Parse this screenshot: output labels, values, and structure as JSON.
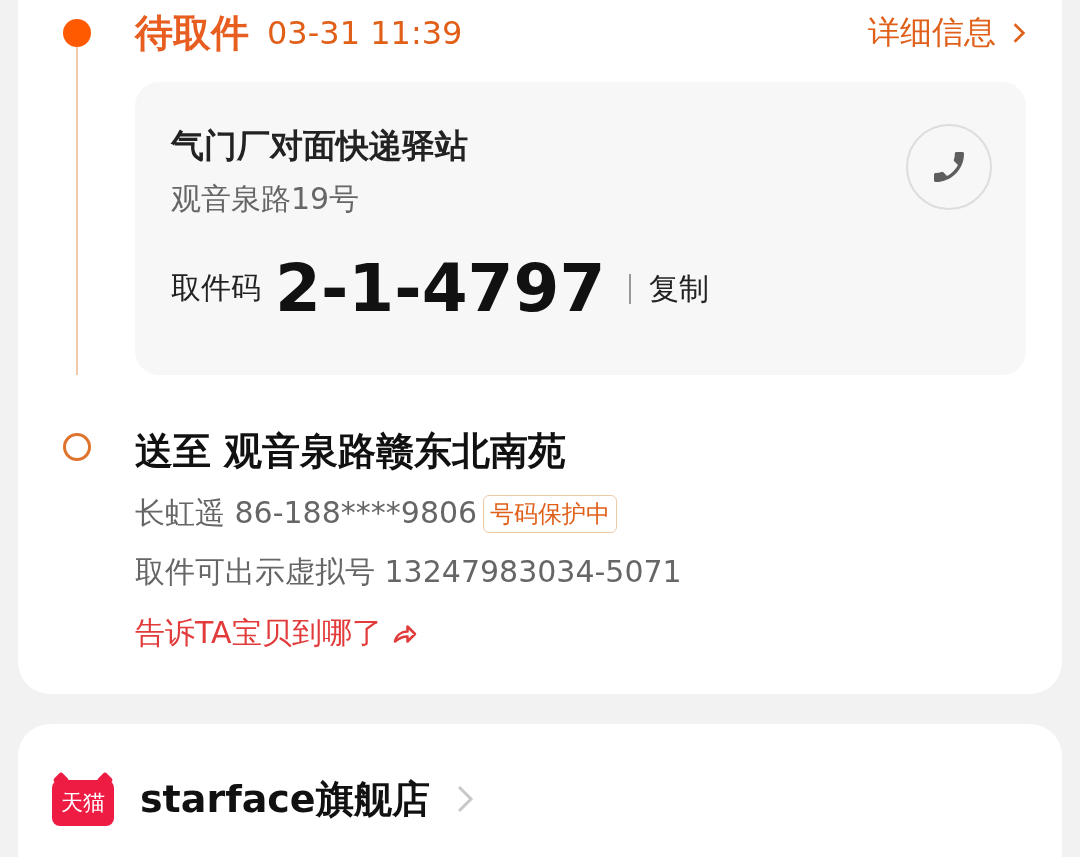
{
  "pickup": {
    "current": true,
    "status": "待取件",
    "time": "03-31 11:39",
    "details_link": "详细信息",
    "station": {
      "name": "气门厂对面快递驿站",
      "address": "观音泉路19号",
      "code_label": "取件码",
      "code": "2-1-4797",
      "copy_button": "复制"
    }
  },
  "delivery": {
    "current": false,
    "destination": "送至 观音泉路赣东北南苑",
    "recipient": "长虹遥 86-188****9806",
    "privacy_badge": "号码保护中",
    "virtual_number": "取件可出示虚拟号 13247983034-5071",
    "share_link": "告诉TA宝贝到哪了"
  },
  "store": {
    "logo_text": "天猫",
    "name": "starface旗舰店"
  }
}
